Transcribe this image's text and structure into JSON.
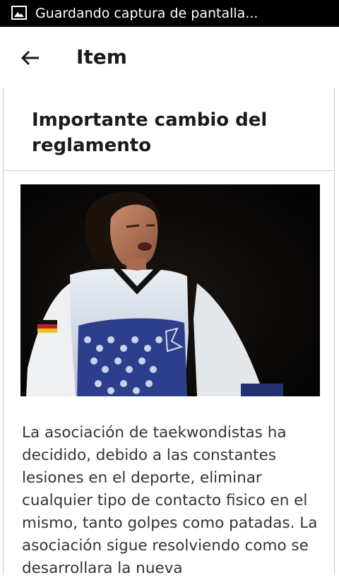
{
  "status_bar": {
    "notification_text": "Guardando captura de pantalla..."
  },
  "app_bar": {
    "title": "Item"
  },
  "article": {
    "title": "Importante cambio del reglamento",
    "body": "La asociación de taekwondistas ha decidido, debido a las constantes lesiones en el deporte, eliminar cualquier tipo de contacto fisico en el mismo, tanto golpes como patadas. La asociación sigue resolviendo como se desarrollara la nueva"
  },
  "icons": {
    "status": "image-icon",
    "back": "arrow-back-icon"
  }
}
